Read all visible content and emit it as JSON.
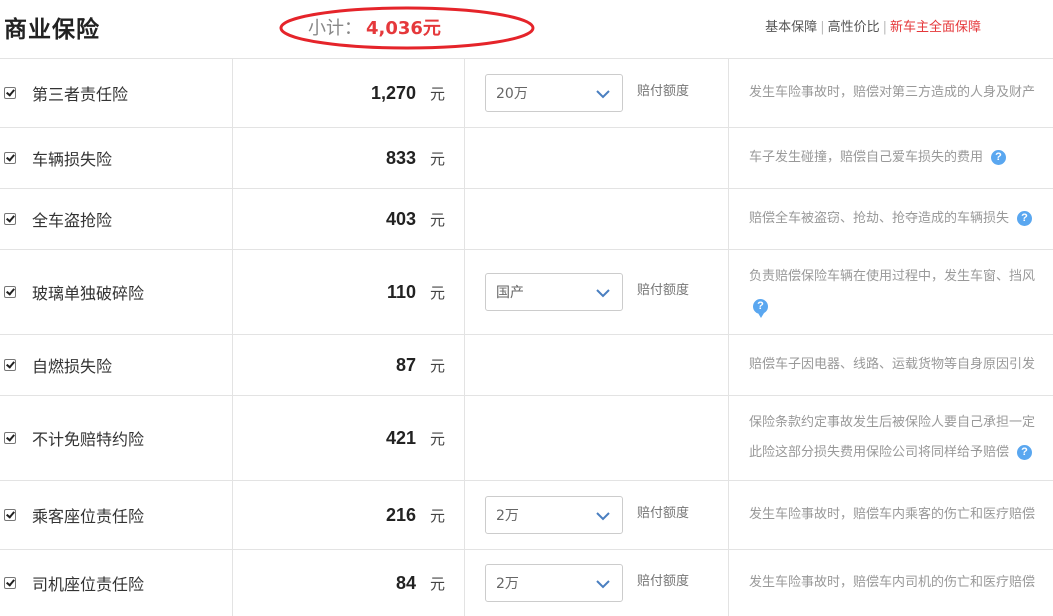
{
  "header": {
    "title": "商业保险",
    "subtotal_label": "小计：",
    "subtotal_amount": "4,036元",
    "nav": [
      {
        "label": "基本保障"
      },
      {
        "label": "高性价比"
      },
      {
        "label": "新车主全面保障"
      }
    ]
  },
  "colors": {
    "accent": "#e5383b",
    "help": "#5aa7f0",
    "border": "#e3e3e3"
  },
  "rows": [
    {
      "name": "第三者责任险",
      "price": "1,270",
      "unit": "元",
      "select": "20万",
      "option_label": "赔付额度",
      "desc_lines": [
        "发生车险事故时，赔偿对第三方造成的人身及财产"
      ],
      "help": false,
      "checked": true
    },
    {
      "name": "车辆损失险",
      "price": "833",
      "unit": "元",
      "desc_lines": [
        "车子发生碰撞，赔偿自己爱车损失的费用"
      ],
      "help": true,
      "checked": true
    },
    {
      "name": "全车盗抢险",
      "price": "403",
      "unit": "元",
      "desc_lines": [
        "赔偿全车被盗窃、抢劫、抢夺造成的车辆损失"
      ],
      "help": true,
      "checked": true
    },
    {
      "name": "玻璃单独破碎险",
      "price": "110",
      "unit": "元",
      "select": "国产",
      "option_label": "赔付额度",
      "desc_lines": [
        "负责赔偿保险车辆在使用过程中，发生车窗、挡风"
      ],
      "help": true,
      "checked": true
    },
    {
      "name": "自燃损失险",
      "price": "87",
      "unit": "元",
      "desc_lines": [
        "赔偿车子因电器、线路、运载货物等自身原因引发"
      ],
      "help": false,
      "checked": true
    },
    {
      "name": "不计免赔特约险",
      "price": "421",
      "unit": "元",
      "desc_lines": [
        "保险条款约定事故发生后被保险人要自己承担一定",
        "此险这部分损失费用保险公司将同样给予赔偿"
      ],
      "help": true,
      "checked": true
    },
    {
      "name": "乘客座位责任险",
      "price": "216",
      "unit": "元",
      "select": "2万",
      "option_label": "赔付额度",
      "desc_lines": [
        "发生车险事故时，赔偿车内乘客的伤亡和医疗赔偿"
      ],
      "help": false,
      "checked": true
    },
    {
      "name": "司机座位责任险",
      "price": "84",
      "unit": "元",
      "select": "2万",
      "option_label": "赔付额度",
      "desc_lines": [
        "发生车险事故时，赔偿车内司机的伤亡和医疗赔偿"
      ],
      "help": false,
      "checked": true
    }
  ]
}
